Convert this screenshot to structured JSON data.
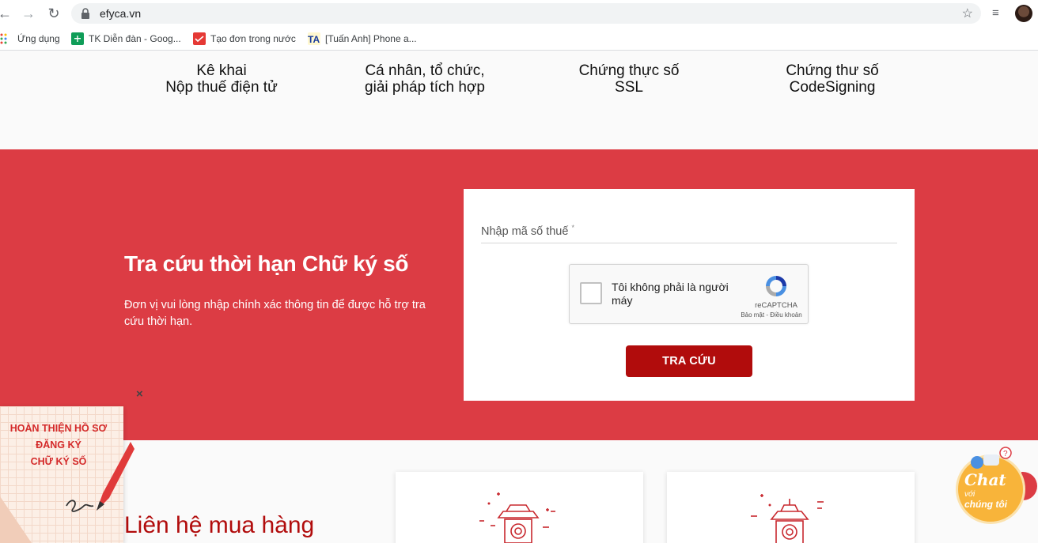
{
  "browser": {
    "url": "efyca.vn",
    "bookmarks": [
      {
        "label": "Ứng dụng",
        "icon": "apps-grid-icon"
      },
      {
        "label": "TK Diễn đàn - Goog...",
        "icon": "sheets-icon"
      },
      {
        "label": "Tạo đơn trong nước",
        "icon": "form-icon"
      },
      {
        "label": "[Tuấn Anh] Phone a...",
        "icon": "ta-logo-icon"
      }
    ]
  },
  "menu": {
    "items": [
      {
        "line1": "Kê khai",
        "line2": "Nộp thuế điện tử"
      },
      {
        "line1": "Cá nhân, tổ chức,",
        "line2": "giải pháp tích hợp"
      },
      {
        "line1": "Chứng thực số",
        "line2": "SSL"
      },
      {
        "line1": "Chứng thư số",
        "line2": "CodeSigning"
      }
    ]
  },
  "lookup": {
    "title": "Tra cứu thời hạn Chữ ký số",
    "description": "Đơn vị vui lòng nhập chính xác thông tin để được hỗ trợ tra cứu thời hạn.",
    "tax_label": "Nhập mã số thuế",
    "required_mark": "*",
    "recaptcha_text": "Tôi không phải là người máy",
    "recaptcha_brand": "reCAPTCHA",
    "recaptcha_links": "Bảo mật - Điều khoản",
    "submit_label": "TRA CỨU"
  },
  "contact": {
    "title": "Liên hệ mua hàng"
  },
  "promo": {
    "line1": "HOÀN THIỆN HỒ SƠ",
    "line2": "ĐĂNG KÝ",
    "line3": "CHỮ KÝ SỐ",
    "close": "×"
  },
  "chat": {
    "line1": "Chat",
    "line2": "với",
    "line3": "chúng tôi",
    "badge": "?"
  },
  "colors": {
    "brand_red": "#dc3c44",
    "button_red": "#b10c0c",
    "chat_orange": "#f8b43a"
  }
}
